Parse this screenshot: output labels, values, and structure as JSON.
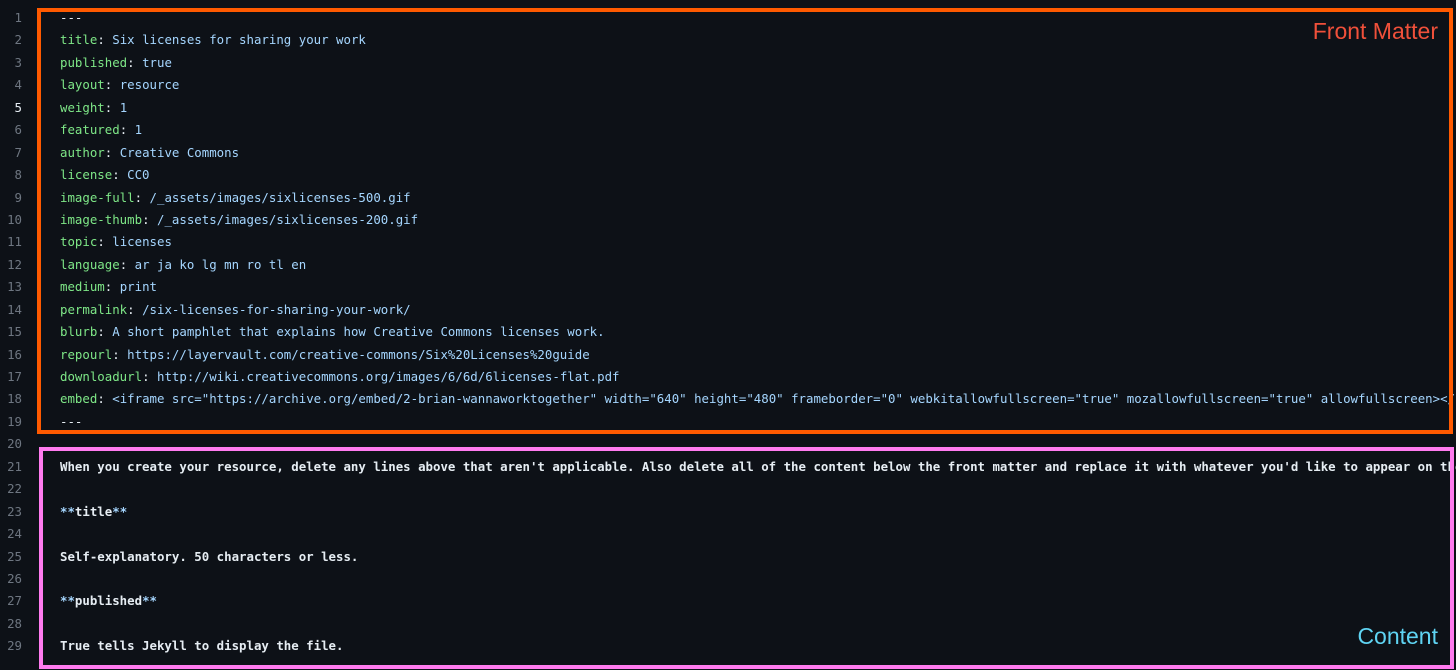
{
  "annotations": {
    "front_matter_label": "Front Matter",
    "content_label": "Content",
    "front_matter_color": "#ff5a00",
    "content_color": "#ff7bef"
  },
  "active_line": 5,
  "lines": [
    {
      "num": "1",
      "parts": [
        {
          "t": "---",
          "c": "p"
        }
      ]
    },
    {
      "num": "2",
      "parts": [
        {
          "t": "title",
          "c": "k"
        },
        {
          "t": ": ",
          "c": "p"
        },
        {
          "t": "Six licenses for sharing your work",
          "c": "v"
        }
      ]
    },
    {
      "num": "3",
      "parts": [
        {
          "t": "published",
          "c": "k"
        },
        {
          "t": ": ",
          "c": "p"
        },
        {
          "t": "true",
          "c": "v"
        }
      ]
    },
    {
      "num": "4",
      "parts": [
        {
          "t": "layout",
          "c": "k"
        },
        {
          "t": ": ",
          "c": "p"
        },
        {
          "t": "resource",
          "c": "v"
        }
      ]
    },
    {
      "num": "5",
      "parts": [
        {
          "t": "weight",
          "c": "k"
        },
        {
          "t": ": ",
          "c": "p"
        },
        {
          "t": "1",
          "c": "v"
        }
      ]
    },
    {
      "num": "6",
      "parts": [
        {
          "t": "featured",
          "c": "k"
        },
        {
          "t": ": ",
          "c": "p"
        },
        {
          "t": "1",
          "c": "v"
        }
      ]
    },
    {
      "num": "7",
      "parts": [
        {
          "t": "author",
          "c": "k"
        },
        {
          "t": ": ",
          "c": "p"
        },
        {
          "t": "Creative Commons",
          "c": "v"
        }
      ]
    },
    {
      "num": "8",
      "parts": [
        {
          "t": "license",
          "c": "k"
        },
        {
          "t": ": ",
          "c": "p"
        },
        {
          "t": "CC0",
          "c": "v"
        }
      ]
    },
    {
      "num": "9",
      "parts": [
        {
          "t": "image-full",
          "c": "k"
        },
        {
          "t": ": ",
          "c": "p"
        },
        {
          "t": "/_assets/images/sixlicenses-500.gif",
          "c": "v"
        }
      ]
    },
    {
      "num": "10",
      "parts": [
        {
          "t": "image-thumb",
          "c": "k"
        },
        {
          "t": ": ",
          "c": "p"
        },
        {
          "t": "/_assets/images/sixlicenses-200.gif",
          "c": "v"
        }
      ]
    },
    {
      "num": "11",
      "parts": [
        {
          "t": "topic",
          "c": "k"
        },
        {
          "t": ": ",
          "c": "p"
        },
        {
          "t": "licenses",
          "c": "v"
        }
      ]
    },
    {
      "num": "12",
      "parts": [
        {
          "t": "language",
          "c": "k"
        },
        {
          "t": ": ",
          "c": "p"
        },
        {
          "t": "ar ja ko lg mn ro tl en",
          "c": "v"
        }
      ]
    },
    {
      "num": "13",
      "parts": [
        {
          "t": "medium",
          "c": "k"
        },
        {
          "t": ": ",
          "c": "p"
        },
        {
          "t": "print",
          "c": "v"
        }
      ]
    },
    {
      "num": "14",
      "parts": [
        {
          "t": "permalink",
          "c": "k"
        },
        {
          "t": ": ",
          "c": "p"
        },
        {
          "t": "/six-licenses-for-sharing-your-work/",
          "c": "v"
        }
      ]
    },
    {
      "num": "15",
      "parts": [
        {
          "t": "blurb",
          "c": "k"
        },
        {
          "t": ": ",
          "c": "p"
        },
        {
          "t": "A short pamphlet that explains how Creative Commons licenses work.",
          "c": "v"
        }
      ]
    },
    {
      "num": "16",
      "parts": [
        {
          "t": "repourl",
          "c": "k"
        },
        {
          "t": ": ",
          "c": "p"
        },
        {
          "t": "https://layervault.com/creative-commons/Six%20Licenses%20guide",
          "c": "v"
        }
      ]
    },
    {
      "num": "17",
      "parts": [
        {
          "t": "downloadurl",
          "c": "k"
        },
        {
          "t": ": ",
          "c": "p"
        },
        {
          "t": "http://wiki.creativecommons.org/images/6/6d/6licenses-flat.pdf",
          "c": "v"
        }
      ]
    },
    {
      "num": "18",
      "parts": [
        {
          "t": "embed",
          "c": "k"
        },
        {
          "t": ": ",
          "c": "p"
        },
        {
          "t": "<iframe src=\"https://archive.org/embed/2-brian-wannaworktogether\" width=\"640\" height=\"480\" frameborder=\"0\" webkitallowfullscreen=\"true\" mozallowfullscreen=\"true\" allowfullscreen></iframe>",
          "c": "v"
        }
      ]
    },
    {
      "num": "19",
      "parts": [
        {
          "t": "---",
          "c": "p"
        }
      ]
    },
    {
      "num": "20",
      "parts": []
    },
    {
      "num": "21",
      "parts": [
        {
          "t": "When you create your resource, delete any lines above that aren't applicable. Also delete all of the content below the front matter and replace it with whatever you'd like to appear on the page.",
          "c": "t"
        }
      ]
    },
    {
      "num": "22",
      "parts": []
    },
    {
      "num": "23",
      "parts": [
        {
          "t": "**",
          "c": "m"
        },
        {
          "t": "title",
          "c": "t"
        },
        {
          "t": "**",
          "c": "m"
        }
      ]
    },
    {
      "num": "24",
      "parts": []
    },
    {
      "num": "25",
      "parts": [
        {
          "t": "Self-explanatory. 50 characters or less.",
          "c": "t"
        }
      ]
    },
    {
      "num": "26",
      "parts": []
    },
    {
      "num": "27",
      "parts": [
        {
          "t": "**",
          "c": "m"
        },
        {
          "t": "published",
          "c": "t"
        },
        {
          "t": "**",
          "c": "m"
        }
      ]
    },
    {
      "num": "28",
      "parts": []
    },
    {
      "num": "29",
      "parts": [
        {
          "t": "True tells Jekyll to display the file.",
          "c": "t"
        }
      ]
    }
  ]
}
